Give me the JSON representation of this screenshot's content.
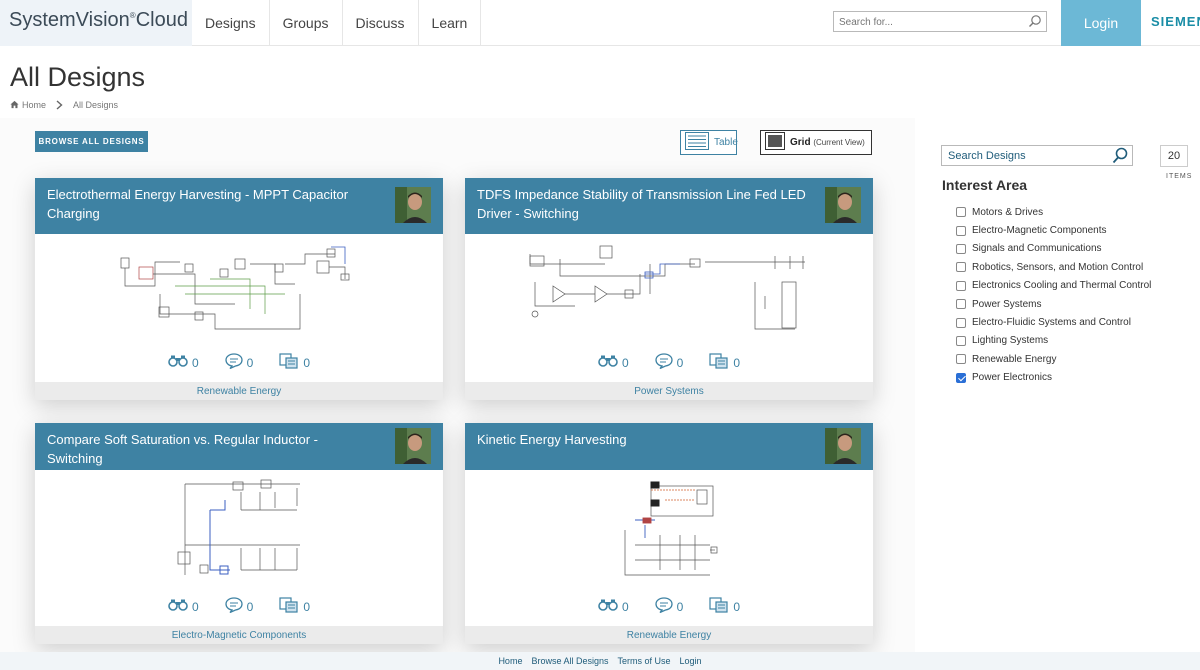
{
  "header": {
    "logo": "SystemVision",
    "logo_mark": "®",
    "logo_suffix": "Cloud",
    "nav": [
      "Designs",
      "Groups",
      "Discuss",
      "Learn"
    ],
    "search_placeholder": "Search for...",
    "login": "Login",
    "brand": "SIEMENS"
  },
  "page": {
    "title": "All Designs",
    "breadcrumb": [
      "Home",
      "All Designs"
    ]
  },
  "toolbar": {
    "browse_all": "BROWSE ALL DESIGNS",
    "table_view": "Table",
    "grid_view": "Grid",
    "grid_current": "(Current View)"
  },
  "cards": [
    {
      "title": "Electrothermal Energy Harvesting - MPPT Capacitor Charging",
      "views": "0",
      "comments": "0",
      "copies": "0",
      "category": "Renewable Energy"
    },
    {
      "title": "TDFS Impedance Stability of Transmission Line Fed LED Driver - Switching",
      "views": "0",
      "comments": "0",
      "copies": "0",
      "category": "Power Systems"
    },
    {
      "title": "Compare Soft Saturation vs. Regular Inductor - Switching",
      "views": "0",
      "comments": "0",
      "copies": "0",
      "category": "Electro-Magnetic Components"
    },
    {
      "title": "Kinetic Energy Harvesting",
      "views": "0",
      "comments": "0",
      "copies": "0",
      "category": "Renewable Energy"
    }
  ],
  "sidebar": {
    "search_placeholder": "Search Designs",
    "items_count": "20",
    "items_label": "ITEMS",
    "interest_title": "Interest Area",
    "filters": [
      {
        "label": "Motors & Drives",
        "checked": false
      },
      {
        "label": "Electro-Magnetic Components",
        "checked": false
      },
      {
        "label": "Signals and Communications",
        "checked": false
      },
      {
        "label": "Robotics, Sensors, and Motion Control",
        "checked": false
      },
      {
        "label": "Electronics Cooling and Thermal Control",
        "checked": false
      },
      {
        "label": "Power Systems",
        "checked": false
      },
      {
        "label": "Electro-Fluidic Systems and Control",
        "checked": false
      },
      {
        "label": "Lighting Systems",
        "checked": false
      },
      {
        "label": "Renewable Energy",
        "checked": false
      },
      {
        "label": "Power Electronics",
        "checked": true
      }
    ]
  },
  "footer": {
    "links": [
      "Home",
      "Browse All Designs",
      "Terms of Use",
      "Login"
    ]
  },
  "colors": {
    "accent": "#3e82a3",
    "login_bg": "#6cb8d6",
    "brand": "#1a8da6",
    "checkbox_checked": "#2a6fd6"
  },
  "icons": [
    "search-icon",
    "home-icon",
    "chevron-right-icon",
    "table-icon",
    "grid-icon",
    "binoculars-icon",
    "comment-icon",
    "copy-icon"
  ]
}
